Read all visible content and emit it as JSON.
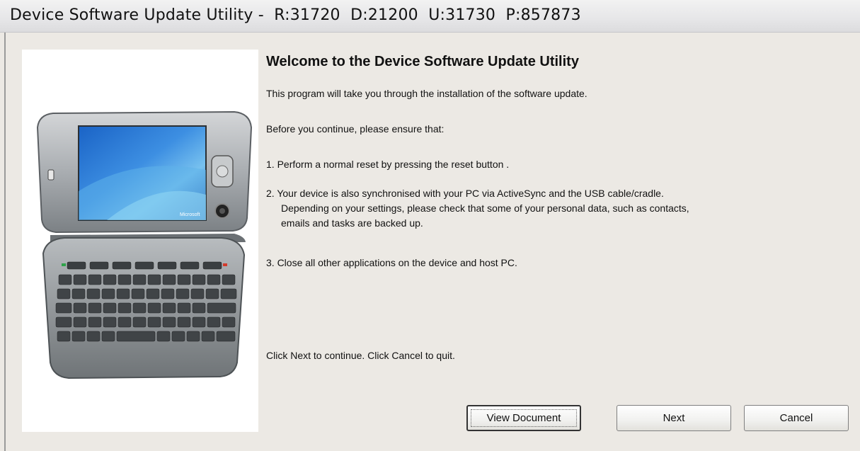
{
  "window": {
    "title": "Device Software Update Utility -  R:31720  D:21200  U:31730  P:857873"
  },
  "main": {
    "heading": "Welcome to the Device Software Update Utility",
    "intro": "This program will take you through the installation of the software update.",
    "before": "Before you continue, please ensure that:",
    "step1": "1. Perform a normal reset by pressing the reset button .",
    "step2_line1": "2. Your device is also synchronised with your PC via ActiveSync and the USB cable/cradle.",
    "step2_line2": "Depending on your settings, please check that some of your personal data, such as contacts,",
    "step2_line3": "emails and tasks are backed up.",
    "step3": "3. Close all other applications on the device and host PC.",
    "footer": "Click Next to continue. Click Cancel to quit."
  },
  "device_image": {
    "screen_logo": "Microsoft"
  },
  "buttons": {
    "view_document": "View Document",
    "next": "Next",
    "cancel": "Cancel"
  }
}
